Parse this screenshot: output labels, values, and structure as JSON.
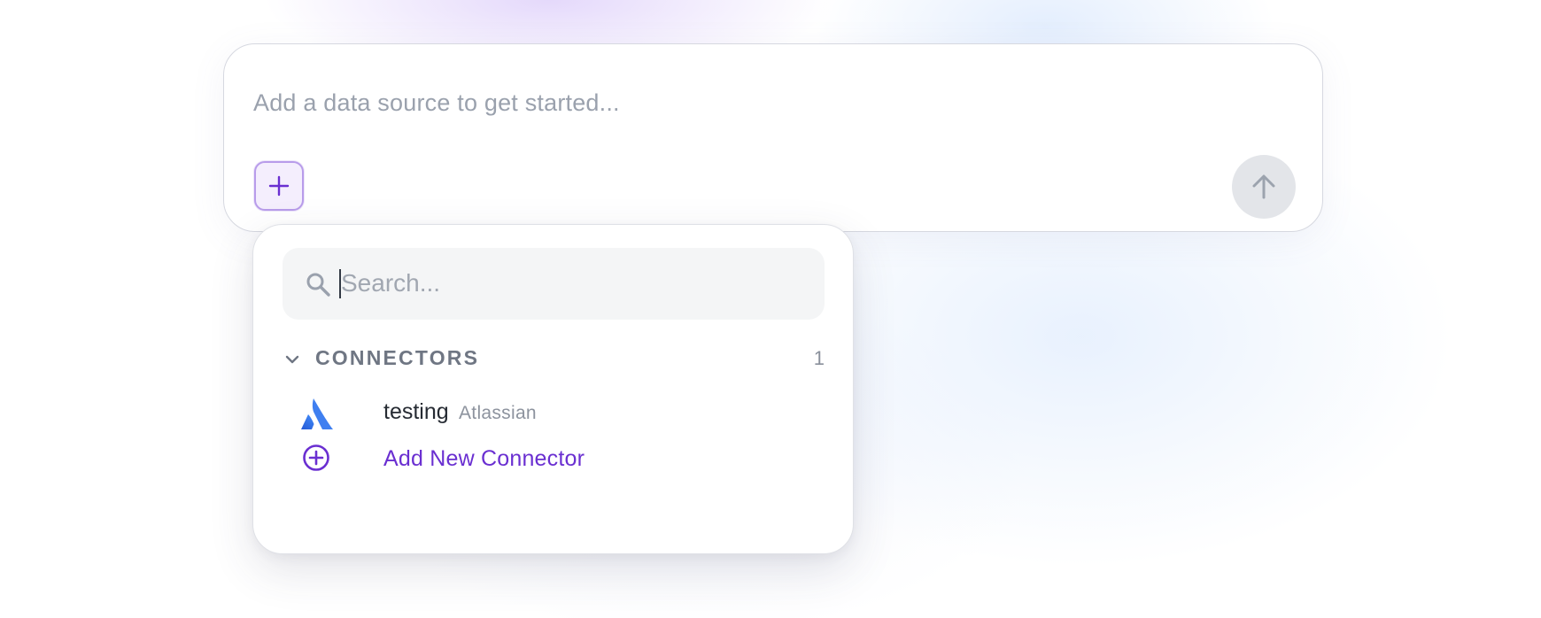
{
  "composer": {
    "placeholder": "Add a data source to get started...",
    "add_button_icon": "plus-icon",
    "send_button_icon": "arrow-up-icon"
  },
  "dropdown": {
    "search": {
      "placeholder": "Search...",
      "value": "",
      "icon": "search-icon"
    },
    "section": {
      "title": "CONNECTORS",
      "count": "1",
      "expanded": true
    },
    "connectors": [
      {
        "name": "testing",
        "vendor": "Atlassian",
        "icon": "atlassian-logo"
      }
    ],
    "add_connector": {
      "label": "Add New Connector",
      "icon": "plus-circle-icon"
    }
  },
  "colors": {
    "accent": "#6a2fd1",
    "accent_border": "#b89cea",
    "atlassian_blue": "#2f6fe4",
    "muted_text": "#9aa1ad"
  }
}
